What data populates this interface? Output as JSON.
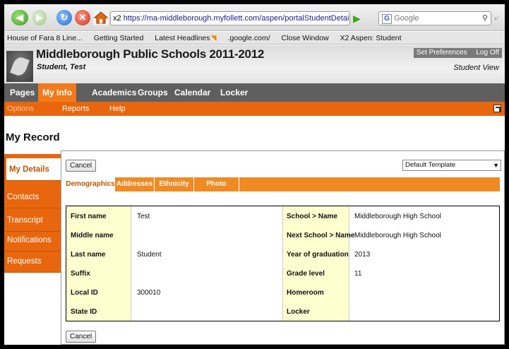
{
  "browser": {
    "url_prefix": "x2",
    "url": "https://ma-middleborough.myfollett.com/aspen/portalStudentDetail.do?navkey=m",
    "search_engine": "Google",
    "bookmarks": [
      "House of Fara 8 Line...",
      "Getting Started",
      "Latest Headlines",
      ".google.com/",
      "Close Window",
      "X2 Aspen: Student"
    ]
  },
  "header": {
    "school": "Middleborough Public Schools 2011-2012",
    "student": "Student, Test",
    "set_preferences": "Set Preferences",
    "log_off": "Log Off",
    "view": "Student View"
  },
  "tabs": [
    "Pages",
    "My Info",
    "Academics",
    "Groups",
    "Calendar",
    "Locker"
  ],
  "active_tab": "My Info",
  "subbar": {
    "options": "Options",
    "reports": "Reports",
    "help": "Help"
  },
  "page_title": "My Record",
  "sidebar": [
    "My Details",
    "Contacts",
    "Transcript",
    "Notifications",
    "Requests"
  ],
  "cancel_label": "Cancel",
  "template": "Default Template",
  "subtabs": [
    "Demographics",
    "Addresses",
    "Ethnicity",
    "Photo"
  ],
  "fields_left": [
    {
      "label": "First name",
      "value": "Test"
    },
    {
      "label": "Middle name",
      "value": ""
    },
    {
      "label": "Last name",
      "value": "Student"
    },
    {
      "label": "Suffix",
      "value": ""
    },
    {
      "label": "Local ID",
      "value": "300010"
    },
    {
      "label": "State ID",
      "value": ""
    }
  ],
  "fields_right": [
    {
      "label": "School > Name",
      "value": "Middleborough High School"
    },
    {
      "label": "Next School > Name",
      "value": "Middleborough High School"
    },
    {
      "label": "Year of graduation",
      "value": "2013"
    },
    {
      "label": "Grade level",
      "value": "11"
    },
    {
      "label": "Homeroom",
      "value": ""
    },
    {
      "label": "Locker",
      "value": ""
    }
  ],
  "colors": {
    "orange": "#e8660d",
    "tab_bar": "#5f5f5f",
    "label_bg": "#ffffd0"
  }
}
